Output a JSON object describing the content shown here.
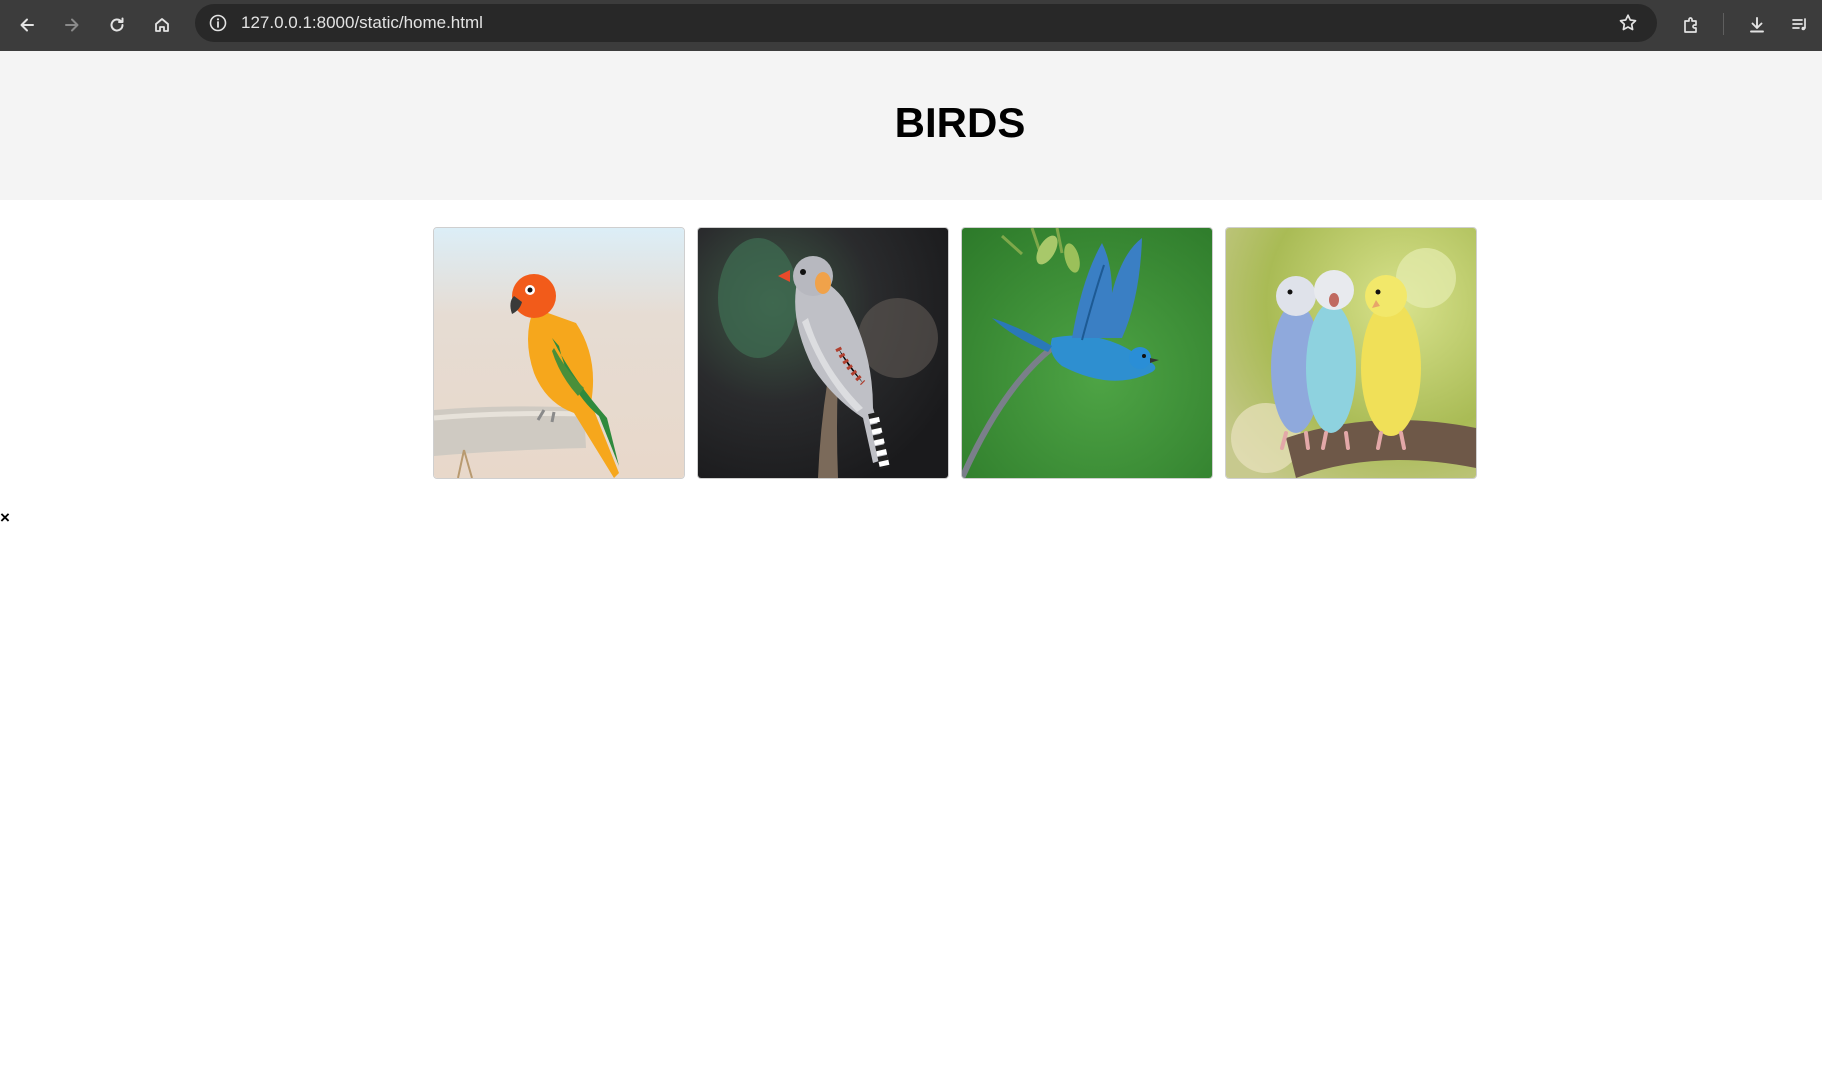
{
  "browser": {
    "url": "127.0.0.1:8000/static/home.html",
    "toolbar_bg": "#3c3c3c",
    "icons": [
      "back-arrow-icon",
      "forward-arrow-icon",
      "reload-icon",
      "home-icon",
      "site-info-icon",
      "bookmark-star-icon",
      "extensions-icon",
      "download-icon",
      "media-controls-icon"
    ]
  },
  "header": {
    "title": "BIRDS",
    "bg": "#f4f4f4"
  },
  "gallery": {
    "images": [
      {
        "name": "sun-conure-parrot-image"
      },
      {
        "name": "zebra-finch-image"
      },
      {
        "name": "blue-bird-in-flight-image"
      },
      {
        "name": "budgerigars-trio-image"
      }
    ]
  },
  "close_button": {
    "label": "×"
  }
}
